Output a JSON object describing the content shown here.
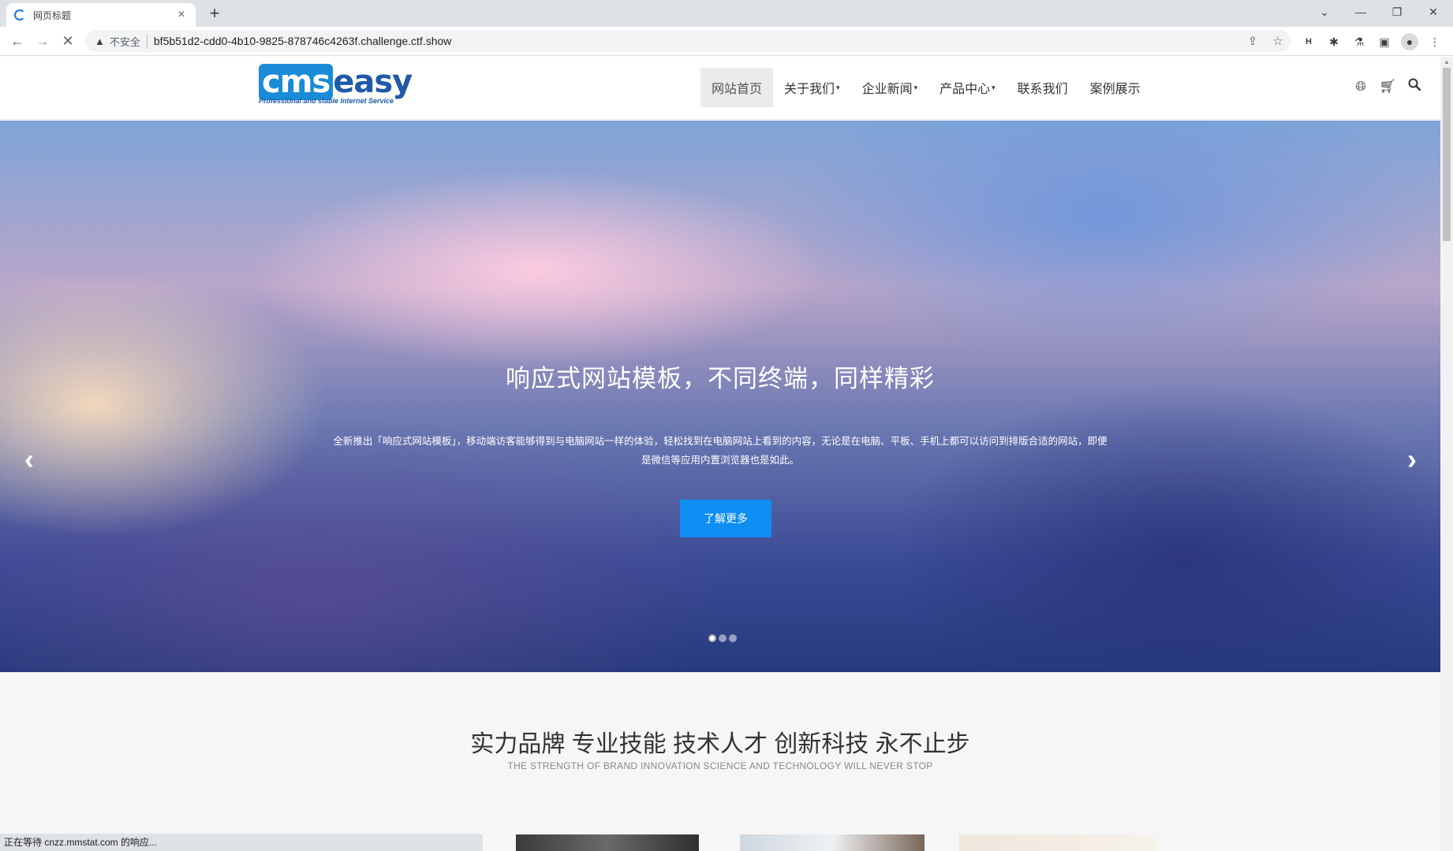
{
  "browser": {
    "tab_title": "网页标题",
    "new_tab_symbol": "+",
    "tab_close_symbol": "×",
    "security_label": "不安全",
    "url": "bf5b51d2-cdd0-4b10-9825-878746c4263f.challenge.ctf.show",
    "status_text": "正在等待 cnzz.mmstat.com 的响应..."
  },
  "site": {
    "logo": {
      "main_left": "cms",
      "main_right": "easy",
      "tagline": "Professional and stable Internet Service"
    },
    "nav": [
      {
        "label": "网站首页",
        "active": true,
        "dropdown": false
      },
      {
        "label": "关于我们",
        "active": false,
        "dropdown": true
      },
      {
        "label": "企业新闻",
        "active": false,
        "dropdown": true
      },
      {
        "label": "产品中心",
        "active": false,
        "dropdown": true
      },
      {
        "label": "联系我们",
        "active": false,
        "dropdown": false
      },
      {
        "label": "案例展示",
        "active": false,
        "dropdown": false
      }
    ],
    "caret": "▾",
    "header_icons": [
      "globe-icon",
      "cart-icon",
      "search-icon"
    ]
  },
  "hero": {
    "title": "响应式网站模板，不同终端，同样精彩",
    "description": "全新推出「响应式网站模板」，移动端访客能够得到与电脑网站一样的体验，轻松找到在电脑网站上看到的内容，无论是在电脑、平板、手机上都可以访问到排版合适的网站，即便是微信等应用内置浏览器也是如此。",
    "button_label": "了解更多",
    "prev_arrow": "‹",
    "next_arrow": "›",
    "slide_count": 3,
    "active_slide": 1
  },
  "brand": {
    "title": "实力品牌 专业技能 技术人才 创新科技 永不止步",
    "subtitle": "THE STRENGTH OF BRAND INNOVATION SCIENCE AND TECHNOLOGY WILL NEVER STOP"
  },
  "colors": {
    "accent": "#0e8ef2",
    "logo_blue": "#1a8bd6",
    "logo_dark_blue": "#1e5aa8"
  }
}
